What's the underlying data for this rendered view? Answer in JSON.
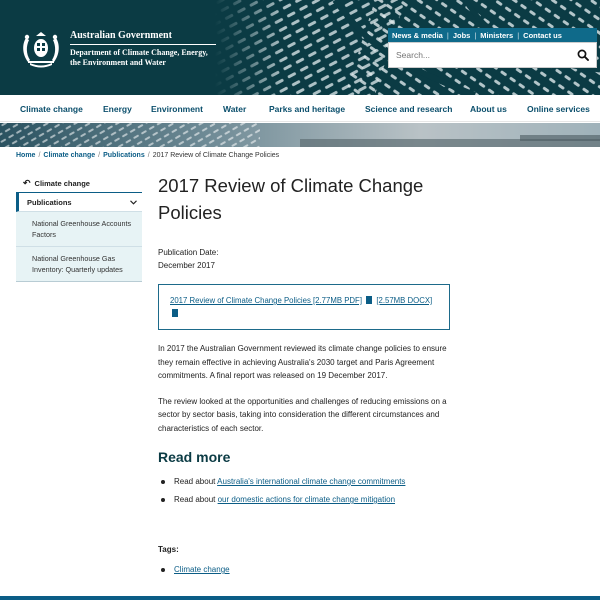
{
  "header": {
    "gov_name": "Australian Government",
    "dept_line1": "Department of Climate Change, Energy,",
    "dept_line2": "the Environment and Water",
    "util_links": [
      "News & media",
      "Jobs",
      "Ministers",
      "Contact us"
    ],
    "search_placeholder": "Search..."
  },
  "nav": {
    "items": [
      "Climate change",
      "Energy",
      "Environment",
      "Water",
      "Parks and heritage",
      "Science and research",
      "About us",
      "Online services"
    ]
  },
  "breadcrumb": {
    "items": [
      "Home",
      "Climate change",
      "Publications"
    ],
    "current": "2017 Review of Climate Change Policies"
  },
  "sidebar": {
    "back_label": "Climate change",
    "section_label": "Publications",
    "sub_items": [
      "National Greenhouse Accounts Factors",
      "National Greenhouse Gas Inventory: Quarterly updates"
    ]
  },
  "content": {
    "title": "2017 Review of Climate Change Policies",
    "pub_date_label": "Publication Date:",
    "pub_date_value": "December 2017",
    "download_pdf": "2017 Review of Climate Change Policies [2.77MB PDF]",
    "download_docx": "[2.57MB DOCX]",
    "para1": "In 2017 the Australian Government reviewed its climate change policies to ensure they remain effective in achieving Australia's 2030 target and Paris Agreement commitments. A final report was released on 19 December 2017.",
    "para2": "The review looked at the opportunities and challenges of reducing emissions on a sector by sector basis, taking into consideration the different circumstances and characteristics of each sector.",
    "read_more_heading": "Read more",
    "read_more": [
      {
        "prefix": "Read about ",
        "link": "Australia's international climate change commitments"
      },
      {
        "prefix": "Read about ",
        "link": "our domestic actions for climate change mitigation"
      }
    ],
    "tags_label": "Tags:",
    "tags": [
      "Climate change"
    ]
  },
  "colors": {
    "header_bg": "#0b3b44",
    "link": "#0b5d86",
    "util_bar": "#0f6a8a",
    "sidebar_sub_bg": "#e7f3f5"
  }
}
